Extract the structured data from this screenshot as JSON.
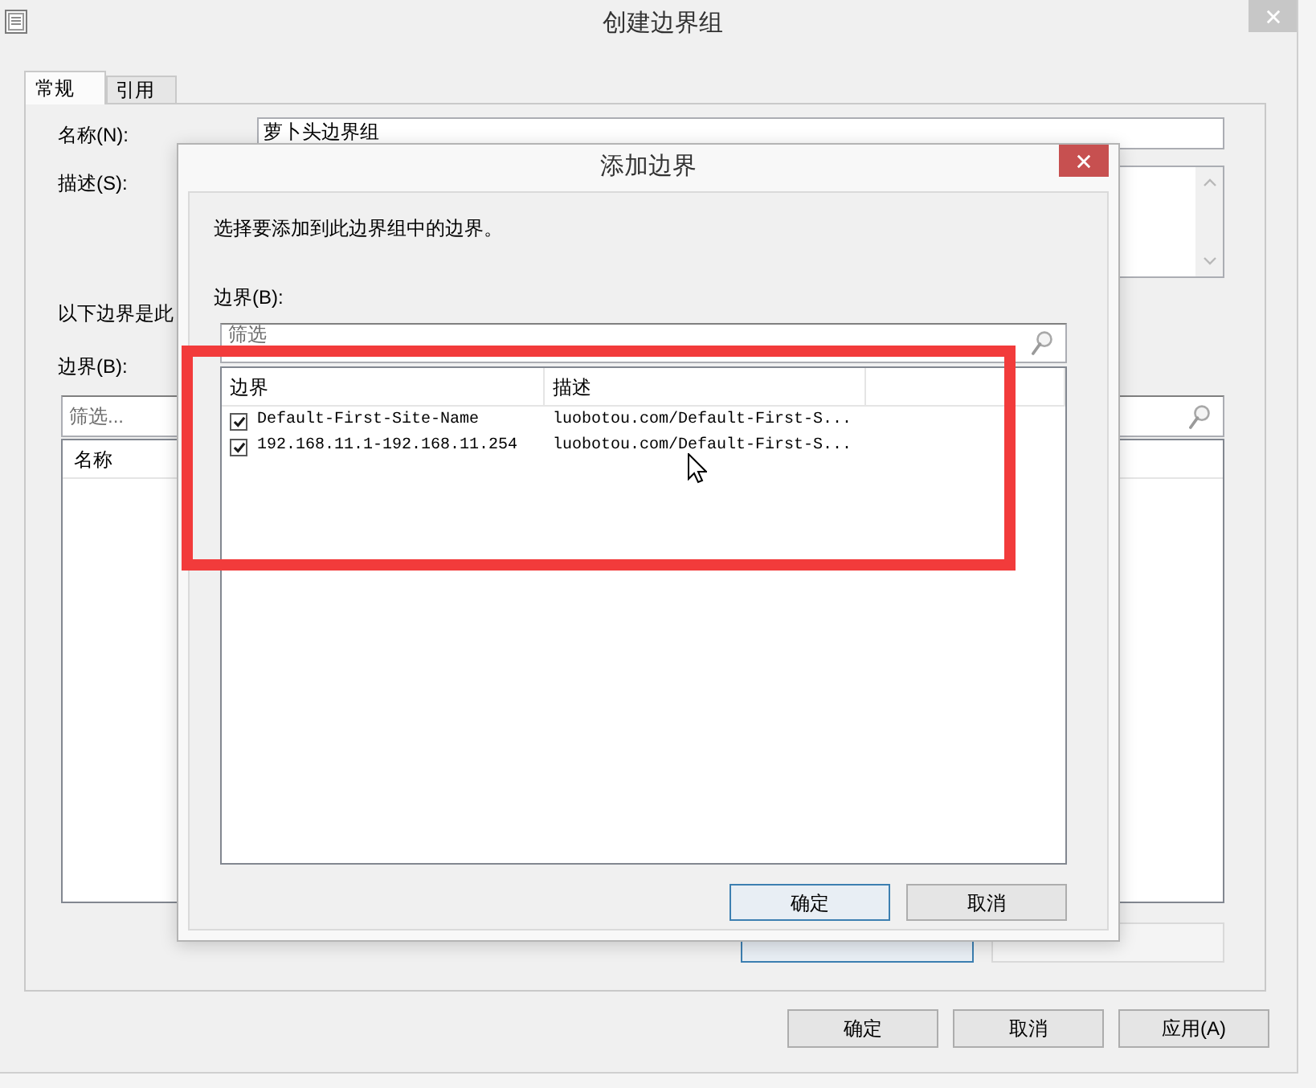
{
  "main_window": {
    "title": "创建边界组"
  },
  "tabs": [
    {
      "label": "常规",
      "selected": true
    },
    {
      "label": "引用",
      "selected": false
    }
  ],
  "general_tab": {
    "name_label": "名称(N):",
    "name_value": "萝卜头边界组",
    "description_label": "描述(S):",
    "boundaries_note": "以下边界是此",
    "boundaries_label": "边界(B):",
    "filter_placeholder": "筛选...",
    "columns": [
      "名称"
    ],
    "list_buttons": [
      {
        "focused": true,
        "disabled": false
      },
      {
        "focused": false,
        "disabled": true
      }
    ]
  },
  "dialog_buttons": [
    {
      "label": "确定"
    },
    {
      "label": "取消"
    },
    {
      "label": "应用(A)"
    }
  ],
  "add_boundary_dialog": {
    "title": "添加边界",
    "instruction": "选择要添加到此边界组中的边界。",
    "boundaries_label": "边界(B):",
    "filter_placeholder": "筛选",
    "columns": [
      "边界",
      "描述"
    ],
    "rows": [
      {
        "checked": true,
        "boundary": "Default-First-Site-Name",
        "description": "luobotou.com/Default-First-S..."
      },
      {
        "checked": true,
        "boundary": "192.168.11.1-192.168.11.254",
        "description": "luobotou.com/Default-First-S..."
      }
    ],
    "buttons": [
      {
        "label": "确定",
        "focused": true
      },
      {
        "label": "取消",
        "focused": false
      }
    ]
  }
}
